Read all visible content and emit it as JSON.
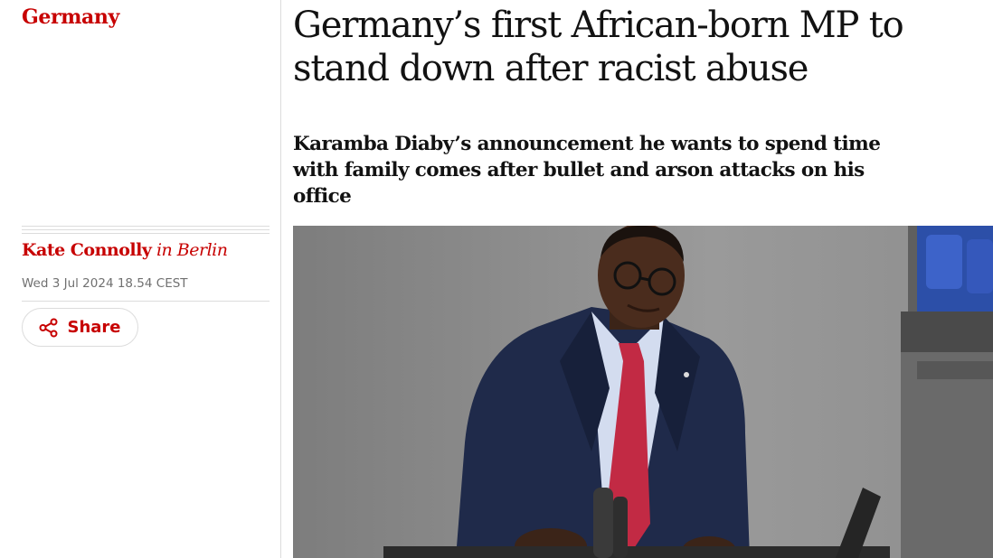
{
  "section": {
    "label": "Germany"
  },
  "article": {
    "headline": "Germany’s first African-born MP to stand down after racist abuse",
    "standfirst": "Karamba Diaby’s announcement he wants to spend time with family comes after bullet and arson attacks on his office"
  },
  "byline": {
    "author": "Kate Connolly",
    "location": "in Berlin"
  },
  "dateline": "Wed 3 Jul 2024 18.54 CEST",
  "share": {
    "label": "Share",
    "icon": "share-icon"
  },
  "colors": {
    "accent": "#c70000",
    "text": "#121212",
    "muted": "#707070",
    "rule": "#dcdcdc"
  }
}
